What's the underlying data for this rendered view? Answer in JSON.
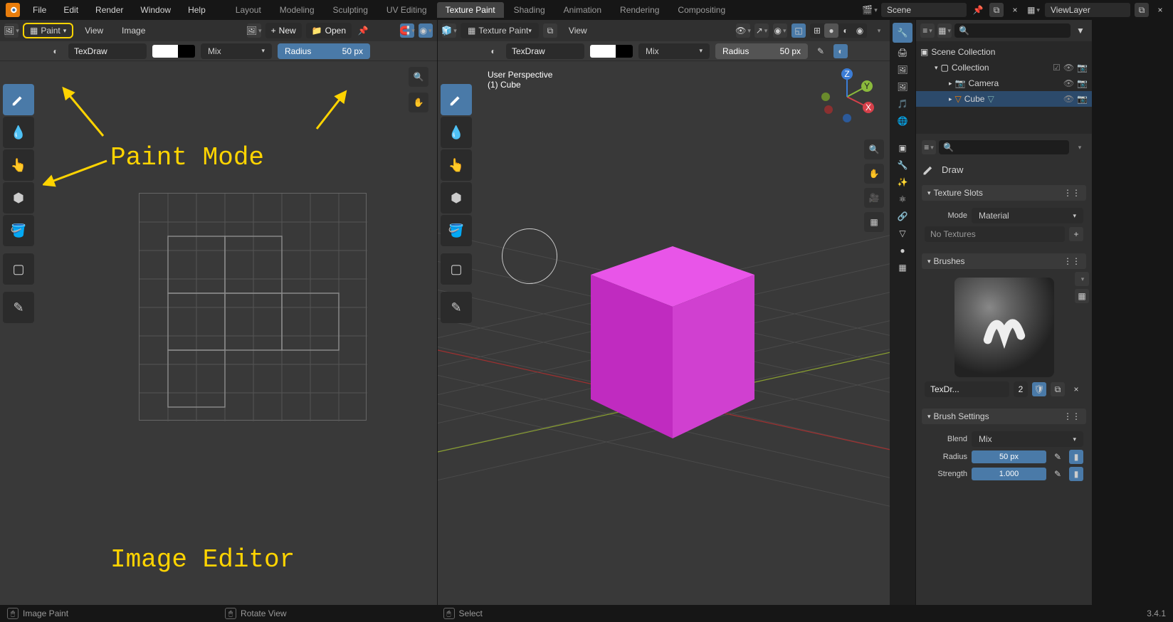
{
  "top_menu": [
    "File",
    "Edit",
    "Render",
    "Window",
    "Help"
  ],
  "workspace_tabs": [
    "Layout",
    "Modeling",
    "Sculpting",
    "UV Editing",
    "Texture Paint",
    "Shading",
    "Animation",
    "Rendering",
    "Compositing"
  ],
  "active_tab": "Texture Paint",
  "scene_name": "Scene",
  "view_layer": "ViewLayer",
  "image_editor": {
    "mode": "Paint",
    "menus": [
      "View",
      "Image"
    ],
    "new_btn": "New",
    "open_btn": "Open",
    "brush_name": "TexDraw",
    "blend": "Mix",
    "radius_label": "Radius",
    "radius_value": "50 px"
  },
  "viewport": {
    "mode": "Texture Paint",
    "menus": [
      "View"
    ],
    "brush_name": "TexDraw",
    "blend": "Mix",
    "radius_label": "Radius",
    "radius_value": "50 px",
    "perspective": "User Perspective",
    "object_label": "(1) Cube"
  },
  "annotations": {
    "paint_mode": "Paint Mode",
    "image_editor": "Image Editor"
  },
  "outliner": {
    "scene_collection": "Scene Collection",
    "collection": "Collection",
    "items": [
      "Camera",
      "Cube"
    ],
    "active": "Cube"
  },
  "props": {
    "tool": "Draw",
    "texture_slots": "Texture Slots",
    "mode_label": "Mode",
    "mode_value": "Material",
    "no_textures": "No Textures",
    "brushes": "Brushes",
    "brush_name": "TexDr...",
    "brush_users": "2",
    "brush_settings": "Brush Settings",
    "blend_label": "Blend",
    "blend_value": "Mix",
    "radius_label": "Radius",
    "radius_value": "50 px",
    "strength_label": "Strength",
    "strength_value": "1.000"
  },
  "footer": {
    "left": "Image Paint",
    "mid": "Rotate View",
    "right": "Select",
    "version": "3.4.1"
  },
  "colors": {
    "cube": "#d92fd9",
    "highlight": "#ffd400",
    "blue": "#4a7aa8"
  }
}
